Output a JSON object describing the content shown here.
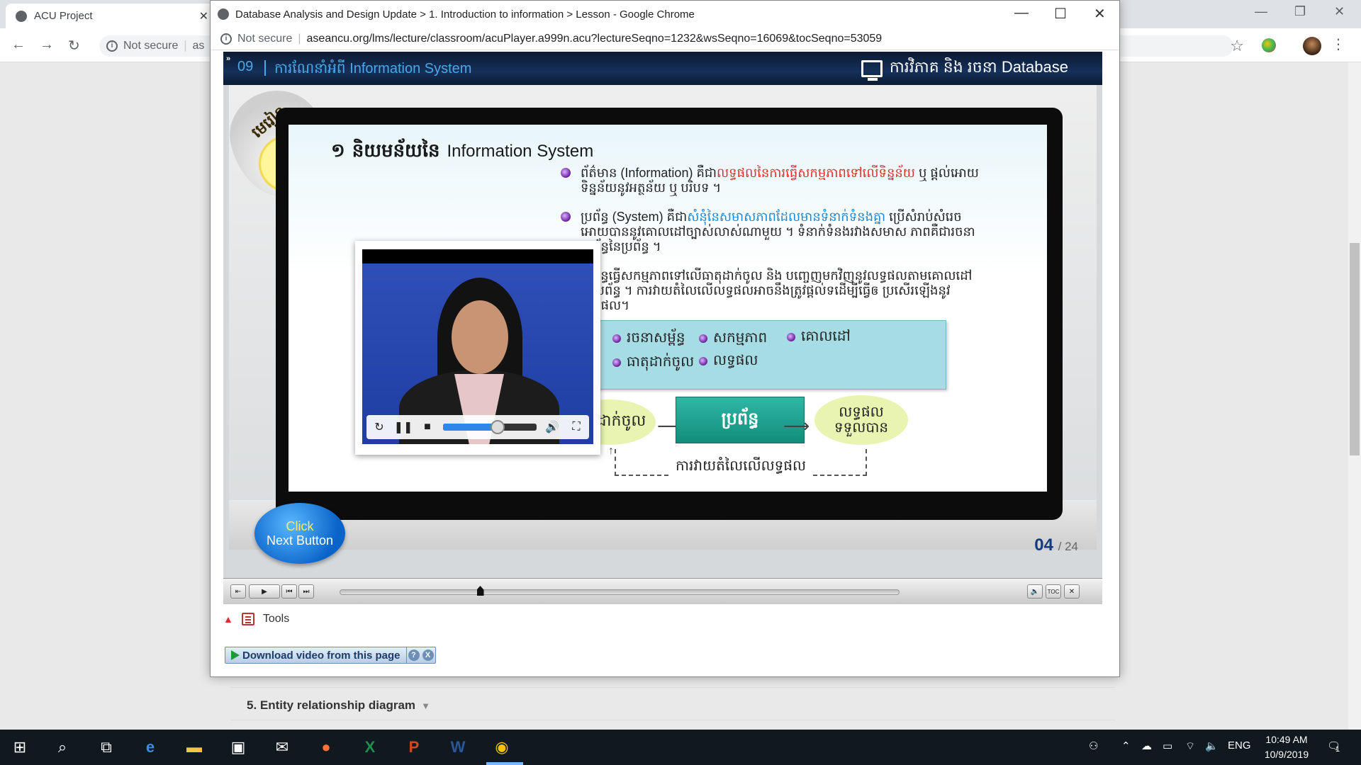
{
  "background_window": {
    "tab_title": "ACU Project",
    "address_security": "Not secure",
    "address_partial": "as"
  },
  "page": {
    "section_item": "5. Entity relationship diagram"
  },
  "popup": {
    "title": "Database Analysis and Design Update > 1. Introduction to information > Lesson - Google Chrome",
    "security_label": "Not secure",
    "url": "aseancu.org/lms/lecture/classroom/acuPlayer.a999n.acu?lectureSeqno=1232&wsSeqno=16069&tocSeqno=53059"
  },
  "player": {
    "lesson_number": "09",
    "lesson_title": "ការណែនាំអំពី Information System",
    "course_title": "ការវិភាគ និង រចនា Database",
    "lamp_label": "មេរៀន",
    "slide": {
      "heading_number": "១",
      "heading_kh": "និយមន័យនៃ",
      "heading_en": "Information System",
      "bullets": [
        {
          "pre": "ព័ត៌មាន (Information) គឺជា",
          "highlight": "លទ្ធផលនៃការធ្វើសកម្មភាពទៅលើទិន្នន័យ",
          "post": " ឬ ផ្តល់អោយ ទិន្នន័យនូវអត្ថន័យ ឬ បរិបទ ។"
        },
        {
          "pre": "ប្រព័ន្ធ (System) គឺជា",
          "highlight": "សំនុំនៃសមាសភាពដែលមានទំនាក់ទំនងគ្នា",
          "post": " ប្រើសំរាប់សំរេច អោយបាននូវគោលដៅច្បាស់លាស់ណាមួយ ។ ទំនាក់ទំនងរវាងសមាស ភាពគឺជារចនាសម្ព័ន្ធនៃប្រព័ន្ធ ។"
        },
        {
          "pre": "ប្រព័ន្ធធ្វើសកម្មភាពទៅលើធាតុដាក់ចូល និង បញ្ចេញមកវិញនូវលទ្ធផលតាមគោលដៅនៃប្រព័ន្ធ ។ ការវាយតំលៃលើលទ្ធផលអាចនឹងត្រូវផ្តល់ទដើម្បីធ្វើឲ ប្រសើរឡើងនូវលទ្ធផល។",
          "highlight": "",
          "post": ""
        }
      ],
      "concepts": [
        "រចនាសម្ព័ន្ធ",
        "សកម្មភាព",
        "គោលដៅ",
        "ធាតុដាក់ចូល",
        "លទ្ធផល"
      ],
      "flow": {
        "input": "ធាតុដាក់ចូល",
        "system": "ប្រព័ន្ធ",
        "output_line1": "លទ្ធផល",
        "output_line2": "ទទួលបាន",
        "feedback": "ការវាយតំលៃលើលទ្ធផល"
      }
    },
    "click_next_line1": "Click",
    "click_next_line2": "Next Button",
    "page_current": "04",
    "page_total": "/ 24",
    "video_seek_fraction": 0.58,
    "lesson_progress_fraction": 0.25,
    "bar_labels": {
      "toc": "TOC"
    }
  },
  "tools": {
    "label": "Tools",
    "download_label": "Download video from this page",
    "help": "?",
    "close": "X"
  },
  "taskbar": {
    "language": "ENG",
    "time": "10:49 AM",
    "date": "10/9/2019",
    "notifications": "1"
  },
  "colors": {
    "player_header": "#0b1a33",
    "accent_blue": "#4aa8e6",
    "highlight_red": "#e0302a",
    "highlight_blue": "#1e88d8",
    "system_box": "#128d7b"
  }
}
